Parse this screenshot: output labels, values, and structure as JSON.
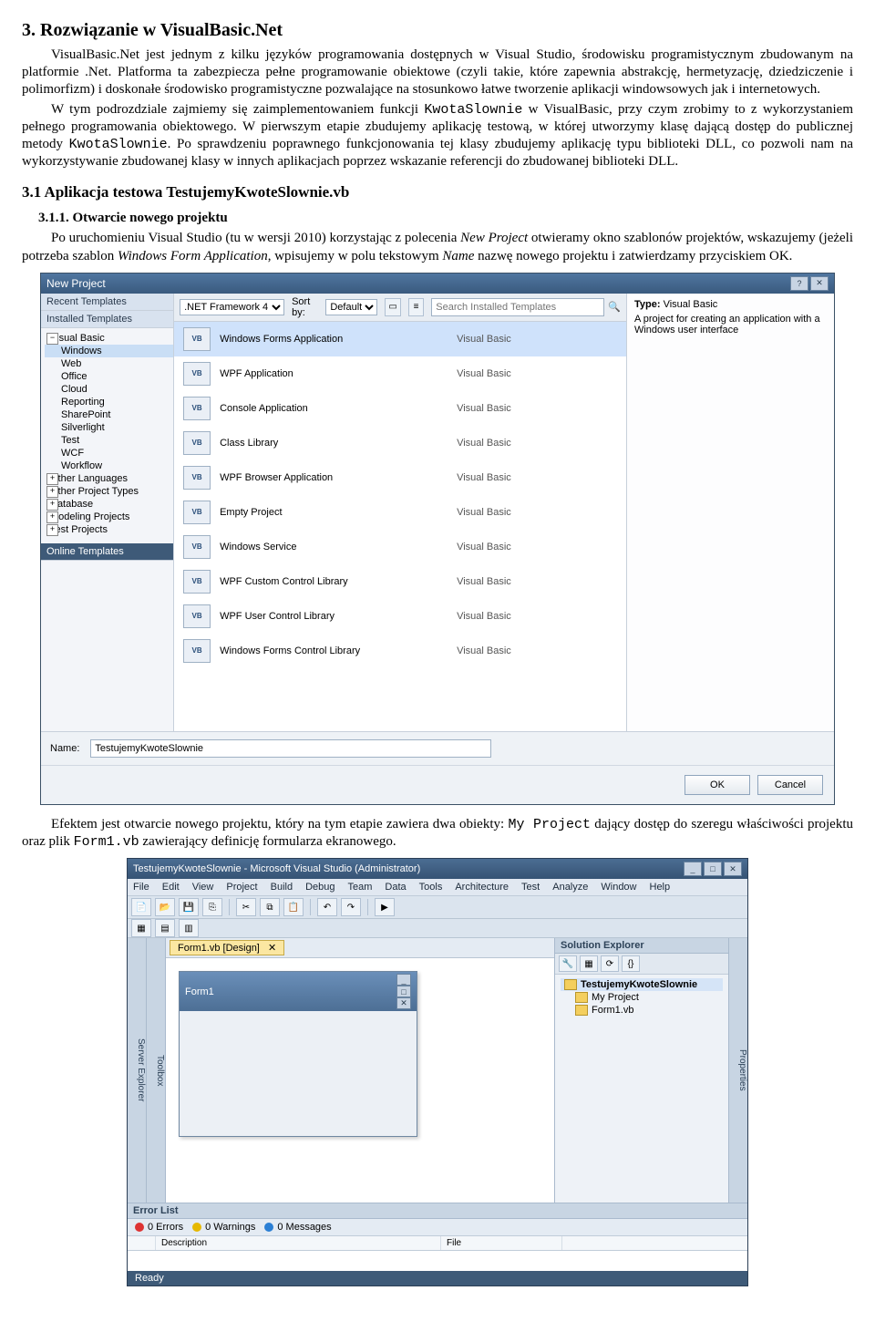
{
  "doc": {
    "h2": "3. Rozwiązanie w VisualBasic.Net",
    "p1_indent": "VisualBasic.Net jest jednym z kilku języków programowania dostępnych w Visual Studio, środowisku programistycznym zbudowanym na platformie .Net. Platforma ta zabezpiecza pełne programowanie obiektowe (czyli takie, które zapewnia abstrakcję, hermetyzację, dziedziczenie i polimorfizm) i doskonałe środowisko programistyczne pozwalające na stosunkowo łatwe tworzenie aplikacji windowsowych jak i internetowych.",
    "p2_a": "W tym podrozdziale zajmiemy się zaimplementowaniem funkcji ",
    "p2_code1": "KwotaSlownie",
    "p2_b": " w VisualBasic, przy czym zrobimy to z wykorzystaniem pełnego programowania obiektowego. W pierwszym etapie zbudujemy aplikację testową, w której utworzymy klasę dającą dostęp do publicznej metody ",
    "p2_code2": "KwotaSlownie",
    "p2_c": ". Po sprawdzeniu poprawnego funkcjonowania tej klasy zbudujemy aplikację typu biblioteki DLL, co pozwoli nam na wykorzystywanie zbudowanej klasy w innych aplikacjach poprzez wskazanie referencji do zbudowanej biblioteki DLL.",
    "h3": "3.1 Aplikacja testowa TestujemyKwoteSlownie.vb",
    "h4": "3.1.1. Otwarcie nowego projektu",
    "p3_a": "Po uruchomieniu Visual Studio (tu w wersji 2010)  korzystając z polecenia ",
    "p3_i1": "New Project",
    "p3_b": " otwieramy okno szablonów projektów, wskazujemy (jeżeli potrzeba szablon ",
    "p3_i2": "Windows Form Application",
    "p3_c": ", wpisujemy w polu tekstowym ",
    "p3_i3": "Name",
    "p3_d": " nazwę nowego projektu i zatwierdzamy przyciskiem OK.",
    "p4_a": "Efektem jest otwarcie nowego projektu, który na tym etapie zawiera dwa obiekty: ",
    "p4_code1": "My Project",
    "p4_b": " dający dostęp do szeregu właściwości projektu oraz plik ",
    "p4_code2": "Form1.vb",
    "p4_c": " zawierający definicję formularza ekranowego."
  },
  "np": {
    "title": "New Project",
    "recent": "Recent Templates",
    "installed": "Installed Templates",
    "online": "Online Templates",
    "tree_vb": "Visual Basic",
    "tree_items": [
      "Windows",
      "Web",
      "Office",
      "Cloud",
      "Reporting",
      "SharePoint",
      "Silverlight",
      "Test",
      "WCF",
      "Workflow"
    ],
    "tree_other": [
      "Other Languages",
      "Other Project Types",
      "Database",
      "Modeling Projects",
      "Test Projects"
    ],
    "fw_label": ".NET Framework 4",
    "sort_label": "Sort by:",
    "sort_value": "Default",
    "search_ph": "Search Installed Templates",
    "templates": [
      {
        "icon": "VB",
        "name": "Windows Forms Application",
        "lang": "Visual Basic",
        "sel": true
      },
      {
        "icon": "VB",
        "name": "WPF Application",
        "lang": "Visual Basic"
      },
      {
        "icon": "VB",
        "name": "Console Application",
        "lang": "Visual Basic"
      },
      {
        "icon": "VB",
        "name": "Class Library",
        "lang": "Visual Basic"
      },
      {
        "icon": "VB",
        "name": "WPF Browser Application",
        "lang": "Visual Basic"
      },
      {
        "icon": "VB",
        "name": "Empty Project",
        "lang": "Visual Basic"
      },
      {
        "icon": "VB",
        "name": "Windows Service",
        "lang": "Visual Basic"
      },
      {
        "icon": "VB",
        "name": "WPF Custom Control Library",
        "lang": "Visual Basic"
      },
      {
        "icon": "VB",
        "name": "WPF User Control Library",
        "lang": "Visual Basic"
      },
      {
        "icon": "VB",
        "name": "Windows Forms Control Library",
        "lang": "Visual Basic"
      }
    ],
    "right_type_lbl": "Type:",
    "right_type_val": "Visual Basic",
    "right_desc": "A project for creating an application with a Windows user interface",
    "name_lbl": "Name:",
    "name_val": "TestujemyKwoteSlownie",
    "ok": "OK",
    "cancel": "Cancel"
  },
  "vs": {
    "title": "TestujemyKwoteSlownie - Microsoft Visual Studio (Administrator)",
    "menus": [
      "File",
      "Edit",
      "View",
      "Project",
      "Build",
      "Debug",
      "Team",
      "Data",
      "Tools",
      "Architecture",
      "Test",
      "Analyze",
      "Window",
      "Help"
    ],
    "doc_tab": "Form1.vb [Design]",
    "form_caption": "Form1",
    "side_left_1": "Server Explorer",
    "side_left_2": "Toolbox",
    "sol_title": "Solution Explorer",
    "sol_root": "TestujemyKwoteSlownie",
    "sol_items": [
      "My Project",
      "Form1.vb"
    ],
    "side_right": "Properties",
    "err_title": "Error List",
    "err_tabs": [
      {
        "color": "#d33",
        "label": "0 Errors"
      },
      {
        "color": "#e6b800",
        "label": "0 Warnings"
      },
      {
        "color": "#2b7fd4",
        "label": "0 Messages"
      }
    ],
    "err_cols": [
      "",
      "Description",
      "File"
    ],
    "status": "Ready"
  }
}
